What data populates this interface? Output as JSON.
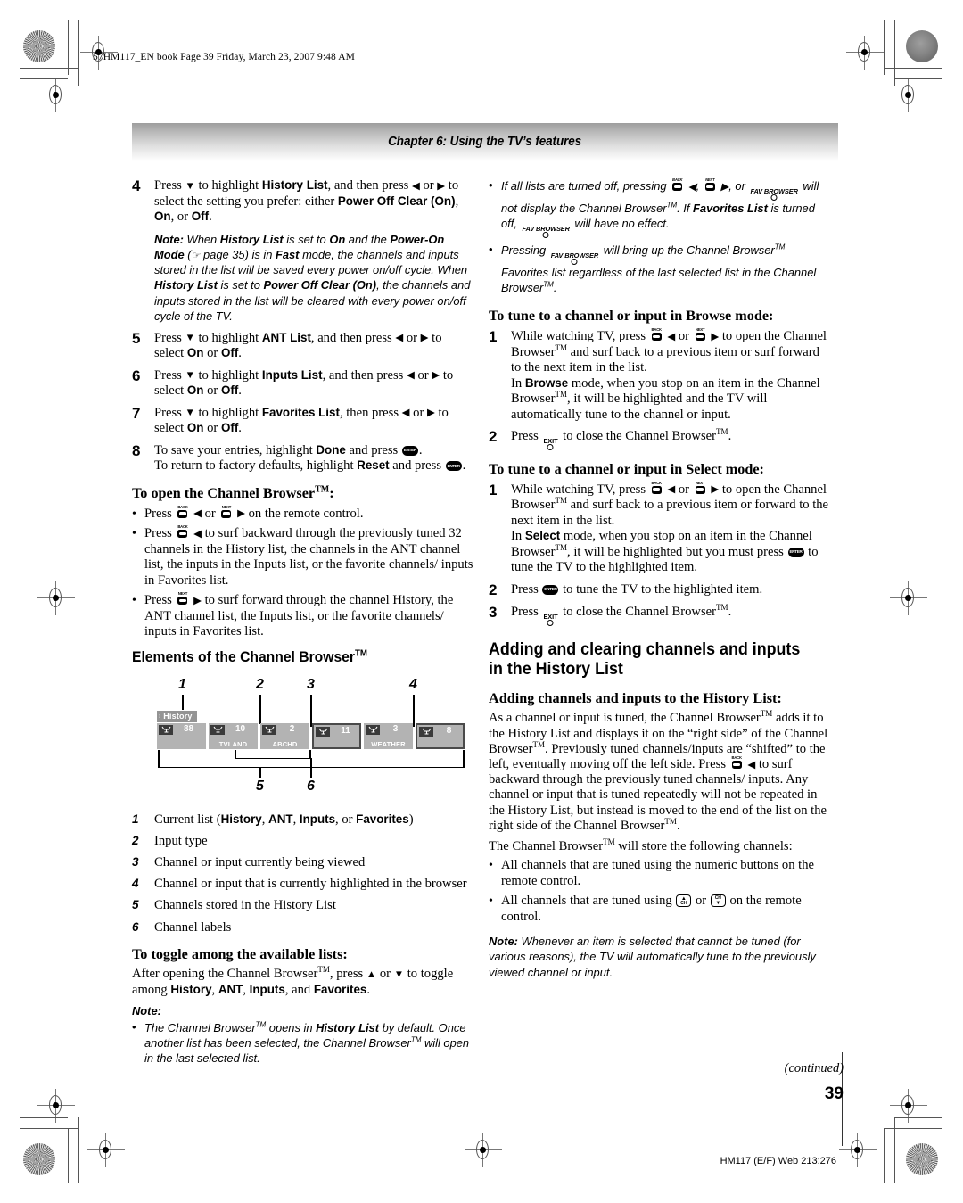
{
  "print": {
    "slug": "57HM117_EN book  Page 39  Friday, March 23, 2007  9:48 AM",
    "chapter_bar": "Chapter 6: Using the TV’s features",
    "page_number": "39",
    "continued": "(continued)",
    "footer_code": "HM117 (E/F) Web 213:276"
  },
  "left_column": {
    "steps": [
      {
        "num": "4",
        "text_html": "Press <span class='arr'>▼</span> to highlight <b>History List</b>, and then press <span class='arr'>◀</span> or <span class='arr'>▶</span> to select the setting you prefer: either <b>Power Off Clear (On)</b>, <b>On</b>, or <b>Off</b>."
      },
      {
        "num": "5",
        "text_html": "Press <span class='arr'>▼</span> to highlight <b>ANT List</b>, and then press <span class='arr'>◀</span> or <span class='arr'>▶</span> to select <b>On</b> or <b>Off</b>."
      },
      {
        "num": "6",
        "text_html": "Press <span class='arr'>▼</span> to highlight <b>Inputs List</b>, and then press <span class='arr'>◀</span> or <span class='arr'>▶</span> to select <b>On</b> or <b>Off</b>."
      },
      {
        "num": "7",
        "text_html": "Press <span class='arr'>▼</span> to highlight <b>Favorites List</b>, then press <span class='arr'>◀</span> or <span class='arr'>▶</span> to select <b>On</b> or <b>Off</b>."
      },
      {
        "num": "8",
        "text_html": "To save your entries, highlight <b>Done</b> and press <span class='key-enter'></span>.<br>To return to factory defaults, highlight <b>Reset</b> and press <span class='key-enter'></span>."
      }
    ],
    "step4_note_html": "<span class='nb'>Note:</span> When <b>History List</b> is set to <b>On</b> and the <b>Power-On Mode</b> (<span class='hand'>☞</span> page 35) is in <b>Fast</b> mode, the channels and inputs stored in the list will be saved every power on/off cycle. When <b>History List</b> is set to <b>Power Off Clear (On)</b>, the channels and inputs stored in the list will be cleared with every power on/off cycle of the TV.",
    "open_browser_heading_html": "To open the Channel Browser<sup class='tm'>TM</sup>:",
    "open_browser_bullets_html": [
      "Press <span class='key-bn'><span class='lbl'>BACK</span><span class='pad'></span></span> <span class='arr'>◀</span> or <span class='key-bn'><span class='lbl'>NEXT</span><span class='pad'></span></span> <span class='arr'>▶</span> on the remote control.",
      "Press <span class='key-bn'><span class='lbl'>BACK</span><span class='pad'></span></span> <span class='arr'>◀</span> to surf backward through the previously tuned 32 channels in the History list, the channels in the ANT channel list, the inputs in the Inputs list, or the favorite channels/ inputs in Favorites list.",
      "Press <span class='key-bn'><span class='lbl'>NEXT</span><span class='pad'></span></span> <span class='arr'>▶</span> to surf forward through the channel History, the ANT channel list, the Inputs list, or the favorite channels/ inputs in Favorites list."
    ],
    "elements_heading_html": "Elements of the Channel Browser<sup class='tm'>TM</sup>",
    "figure": {
      "callouts_top": [
        "1",
        "2",
        "3",
        "4"
      ],
      "callouts_bottom": [
        "5",
        "6"
      ],
      "list_tab_label": "History",
      "channels": [
        {
          "number": "88",
          "label": "",
          "style": "plain"
        },
        {
          "number": "10",
          "label": "TVLAND",
          "style": "plain"
        },
        {
          "number": "2",
          "label": "ABCHD",
          "style": "plain"
        },
        {
          "number": "11",
          "label": "",
          "style": "outline"
        },
        {
          "number": "3",
          "label": "WEATHER",
          "style": "plain"
        },
        {
          "number": "8",
          "label": "",
          "style": "outline"
        }
      ]
    },
    "figure_legend": [
      {
        "n": "1",
        "text_html": "Current list (<b>History</b>, <b>ANT</b>, <b>Inputs</b>, or <b>Favorites</b>)"
      },
      {
        "n": "2",
        "text_html": "Input type"
      },
      {
        "n": "3",
        "text_html": "Channel or input currently being viewed"
      },
      {
        "n": "4",
        "text_html": "Channel or input that is currently highlighted in the browser"
      },
      {
        "n": "5",
        "text_html": "Channels stored in the History List"
      },
      {
        "n": "6",
        "text_html": "Channel labels"
      }
    ],
    "toggle_heading_html": "To toggle among the available lists:",
    "toggle_body_html": "After opening the Channel Browser<sup class='tm'>TM</sup>, press <span class='arr'>▲</span> or <span class='arr'>▼</span> to toggle among <b>History</b>, <b>ANT</b>, <b>Inputs</b>, and <b>Favorites</b>.",
    "toggle_note_label": "Note:",
    "toggle_note_bullet_html": "The Channel Browser<sup class='tm'>TM</sup> opens in <b>History List</b> by default. Once another list has been selected, the Channel Browser<sup class='tm'>TM</sup> will open in the last selected list."
  },
  "right_column": {
    "top_note_bullets_html": [
      "If all lists are turned off, pressing <span class='key-bn'><span class='lbl'>BACK</span><span class='pad'></span></span> <span class='arr'>◀</span>, <span class='key-bn'><span class='lbl'>NEXT</span><span class='pad'></span></span> <span class='arr'>▶</span>, or <span class='key-txt'>FAV BROWSER<span class='circ'></span></span> will not display the Channel Browser<sup class='tm'>TM</sup>. If <b>Favorites List</b> is turned off, <span class='key-txt'>FAV BROWSER<span class='circ'></span></span> will have no effect.",
      "Pressing <span class='key-txt'>FAV BROWSER<span class='circ'></span></span> will bring up the Channel Browser<sup class='tm'>TM</sup> Favorites list regardless of the last selected list in the Channel Browser<sup class='tm'>TM</sup>."
    ],
    "browse_heading_html": "To tune to a channel or input in Browse mode:",
    "browse_steps": [
      {
        "num": "1",
        "text_html": "While watching TV, press <span class='key-bn'><span class='lbl'>BACK</span><span class='pad'></span></span> <span class='arr'>◀</span> or <span class='key-bn'><span class='lbl'>NEXT</span><span class='pad'></span></span> <span class='arr'>▶</span> to open the Channel Browser<sup class='tm'>TM</sup> and surf back to a previous item or surf forward to the next item in the list.<br>In <b>Browse</b> mode, when you stop on an item in the Channel Browser<sup class='tm'>TM</sup>, it will be highlighted and the TV will automatically tune to the channel or input."
      },
      {
        "num": "2",
        "text_html": "Press <span class='key-txt'>EXIT<span class='circ'></span></span> to close the Channel Browser<sup class='tm'>TM</sup>."
      }
    ],
    "select_heading_html": "To tune to a channel or input in Select mode:",
    "select_steps": [
      {
        "num": "1",
        "text_html": "While watching TV, press <span class='key-bn'><span class='lbl'>BACK</span><span class='pad'></span></span> <span class='arr'>◀</span> or <span class='key-bn'><span class='lbl'>NEXT</span><span class='pad'></span></span> <span class='arr'>▶</span> to open the Channel Browser<sup class='tm'>TM</sup> and surf back to a previous item or forward to the next item in the list.<br>In <b>Select</b> mode, when you stop on an item in the Channel Browser<sup class='tm'>TM</sup>, it will be highlighted but you must press <span class='key-enter'></span> to tune the TV to the highlighted item."
      },
      {
        "num": "2",
        "text_html": "Press <span class='key-enter'></span> to tune the TV to the highlighted item."
      },
      {
        "num": "3",
        "text_html": "Press <span class='key-txt'>EXIT<span class='circ'></span></span> to close the Channel Browser<sup class='tm'>TM</sup>."
      }
    ],
    "adding_heading": "Adding and clearing channels and inputs in the History List",
    "adding_sub_heading": "Adding channels and inputs to the History List:",
    "adding_body_html": "As a channel or input is tuned, the Channel Browser<sup class='tm'>TM</sup> adds it to the History List and displays it on the “right side” of the Channel Browser<sup class='tm'>TM</sup>. Previously tuned channels/inputs are “shifted” to the left, eventually moving off the left side. Press <span class='key-bn'><span class='lbl'>BACK</span><span class='pad'></span></span> <span class='arr'>◀</span> to surf backward through the previously tuned channels/ inputs. Any channel or input that is tuned repeatedly will not be repeated in the History List, but instead is moved to the end of the list on the right side of the Channel Browser<sup class='tm'>TM</sup>.",
    "store_intro_html": "The Channel Browser<sup class='tm'>TM</sup> will store the following channels:",
    "store_bullets_html": [
      "All channels that are tuned using the numeric buttons on the remote control.",
      "All channels that are tuned using <span class='key-ch up'><span class='ar'>▲</span><span class='ch'>CH</span></span> or <span class='key-ch dn'><span class='ch'>CH</span><span class='ar'>▼</span></span> on the remote control."
    ],
    "bottom_note_html": "<span class='nb'>Note:</span> Whenever an item is selected that cannot be tuned (for various reasons), the TV will automatically tune to the previously viewed channel or input."
  }
}
